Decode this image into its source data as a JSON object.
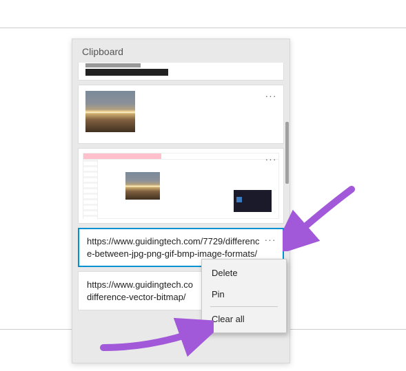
{
  "panel": {
    "title": "Clipboard"
  },
  "entries": {
    "selected_url": "https://www.guidingtech.com/7729/difference-between-jpg-png-gif-bmp-image-formats/",
    "partial_url": "https://www.guidingtech.co\ndifference-vector-bitmap/"
  },
  "icons": {
    "more": "···"
  },
  "menu": {
    "delete": "Delete",
    "pin": "Pin",
    "clear_all": "Clear all"
  }
}
